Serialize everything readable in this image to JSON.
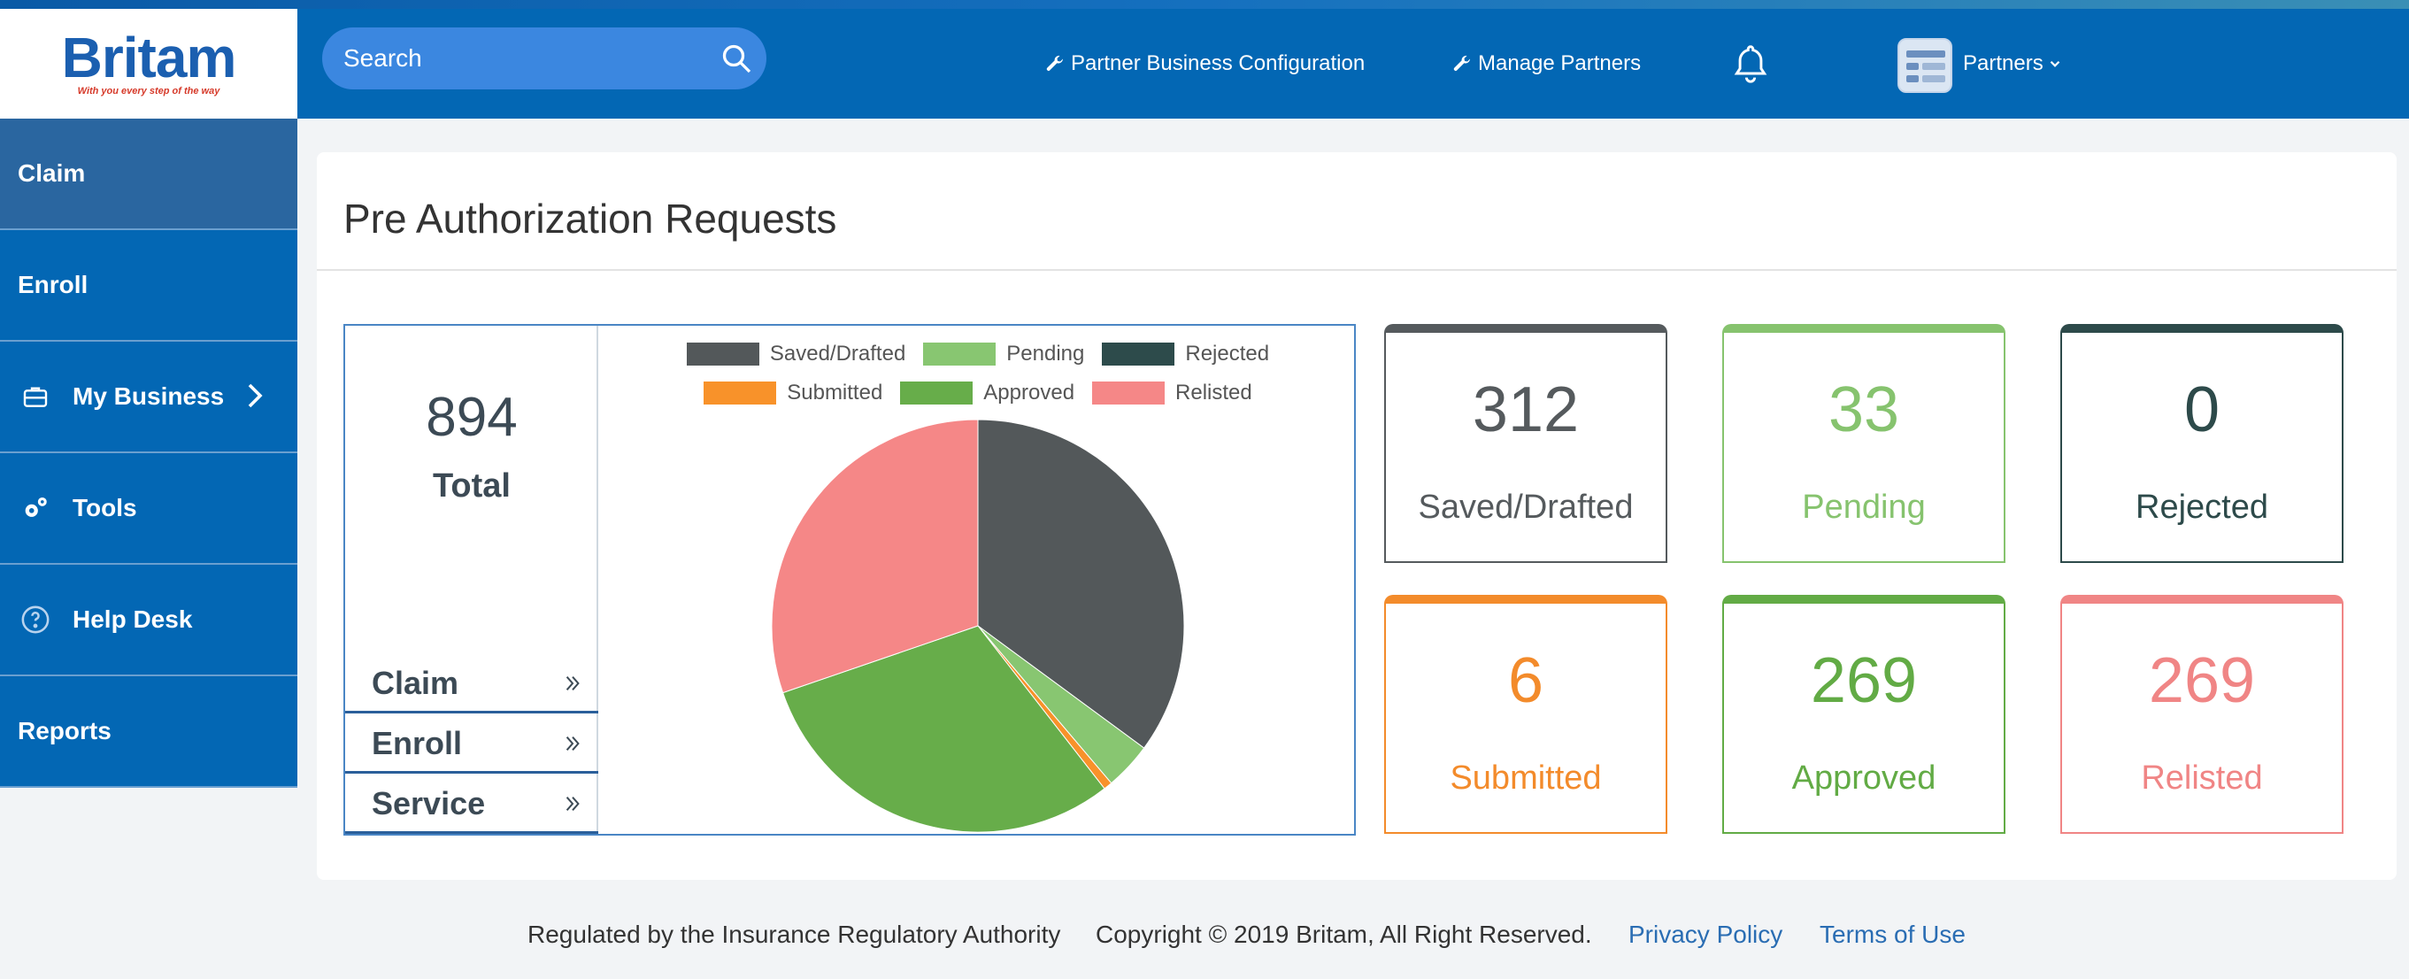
{
  "brand": {
    "name": "Britam",
    "tagline": "With you every step of the way",
    "primary_color": "#0367b4"
  },
  "header": {
    "search_placeholder": "Search",
    "nav": [
      {
        "label": "Partner Business Configuration",
        "icon": "wrench-icon"
      },
      {
        "label": "Manage Partners",
        "icon": "wrench-icon"
      }
    ],
    "notifications_icon": "bell-icon",
    "account_label": "Partners"
  },
  "sidebar": {
    "items": [
      {
        "label": "Claim",
        "active": true
      },
      {
        "label": "Enroll"
      },
      {
        "label": "My Business",
        "icon": "briefcase-icon",
        "has_submenu": true
      },
      {
        "label": "Tools",
        "icon": "gears-icon"
      },
      {
        "label": "Help Desk",
        "icon": "question-circle-icon"
      },
      {
        "label": "Reports"
      }
    ]
  },
  "main": {
    "title": "Pre Authorization Requests",
    "total": {
      "value": "894",
      "label": "Total"
    },
    "links": [
      {
        "label": "Claim"
      },
      {
        "label": "Enroll"
      },
      {
        "label": "Service"
      }
    ],
    "stats": [
      {
        "value": "312",
        "label": "Saved/Drafted",
        "color": "#555a5d"
      },
      {
        "value": "33",
        "label": "Pending",
        "color": "#86c36e"
      },
      {
        "value": "0",
        "label": "Rejected",
        "color": "#2d4a4a"
      },
      {
        "value": "6",
        "label": "Submitted",
        "color": "#f38b2b"
      },
      {
        "value": "269",
        "label": "Approved",
        "color": "#62ab45"
      },
      {
        "value": "269",
        "label": "Relisted",
        "color": "#f08585"
      }
    ]
  },
  "chart_data": {
    "type": "pie",
    "legend_position": "top",
    "slices": [
      {
        "label": "Saved/Drafted",
        "value": 312,
        "color": "#53585a"
      },
      {
        "label": "Pending",
        "value": 33,
        "color": "#88c671"
      },
      {
        "label": "Rejected",
        "value": 0,
        "color": "#2d4b4b"
      },
      {
        "label": "Submitted",
        "value": 6,
        "color": "#f8922a"
      },
      {
        "label": "Approved",
        "value": 269,
        "color": "#67ad4a"
      },
      {
        "label": "Relisted",
        "value": 269,
        "color": "#f58787"
      }
    ]
  },
  "footer": {
    "regulated": "Regulated by the Insurance Regulatory Authority",
    "copyright": "Copyright © 2019 Britam, All Right Reserved.",
    "privacy": "Privacy Policy",
    "terms": "Terms of Use"
  }
}
